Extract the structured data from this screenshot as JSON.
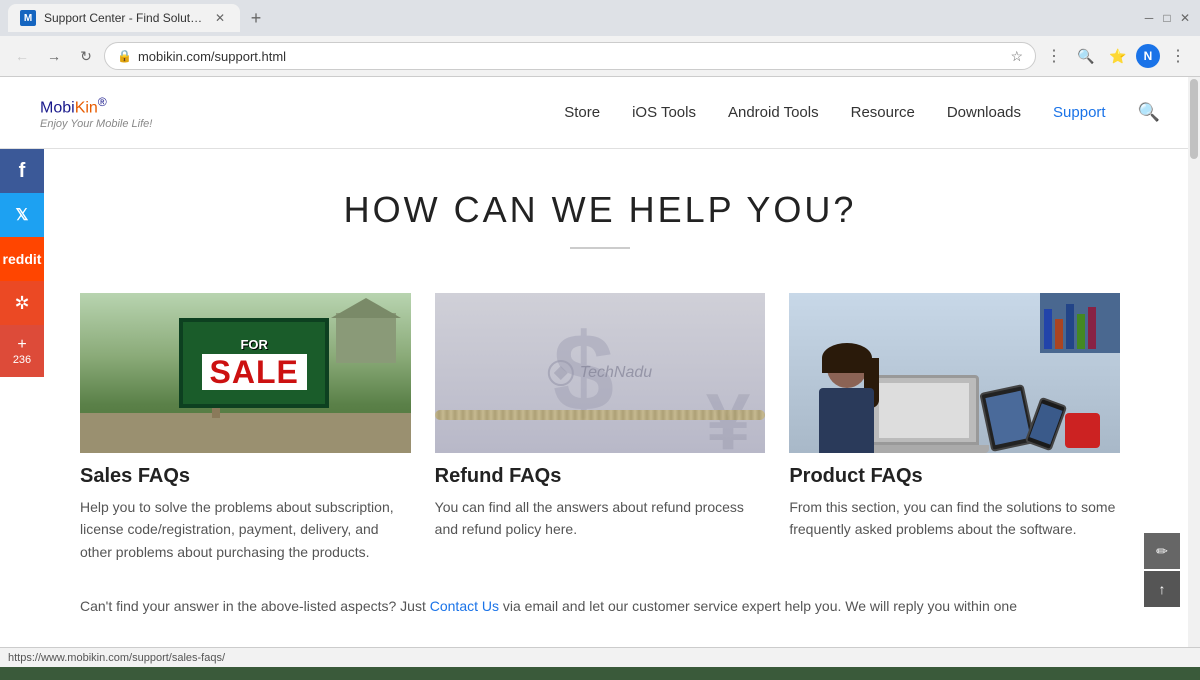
{
  "browser": {
    "title": "Support Center - Find Solutions",
    "tab_label": "Support Center - Find Solutions",
    "url": "mobikin.com/support.html",
    "status_url": "https://www.mobikin.com/support/sales-faqs/"
  },
  "site": {
    "logo_mobi": "Mobi",
    "logo_kin": "Kin",
    "logo_registered": "®",
    "tagline": "Enjoy Your Mobile Life!",
    "nav": {
      "store": "Store",
      "ios_tools": "iOS Tools",
      "android_tools": "Android Tools",
      "resource": "Resource",
      "downloads": "Downloads",
      "support": "Support"
    }
  },
  "hero": {
    "title": "HOW CAN WE HELP YOU?"
  },
  "social": {
    "facebook": "f",
    "twitter": "t",
    "reddit": "r",
    "stumbleupon": "✲",
    "plus": "+",
    "plus_count": "236"
  },
  "faq_cards": [
    {
      "id": "sales",
      "title": "Sales FAQs",
      "description": "Help you to solve the problems about subscription, license code/registration, payment, delivery, and other problems about purchasing the products.",
      "image_label": "for-sale-sign-image"
    },
    {
      "id": "refund",
      "title": "Refund FAQs",
      "description": "You can find all the answers about refund process and refund policy here.",
      "image_label": "refund-image"
    },
    {
      "id": "product",
      "title": "Product FAQs",
      "description": "From this section, you can find the solutions to some frequently asked problems about the software.",
      "image_label": "product-image"
    }
  ],
  "bottom": {
    "text_before": "Can't find your answer in the above-listed aspects? Just ",
    "contact_link": "Contact Us",
    "text_after": " via email and let our customer service expert help you. We will reply you within one"
  },
  "technadu": {
    "watermark": "TechNadu"
  }
}
